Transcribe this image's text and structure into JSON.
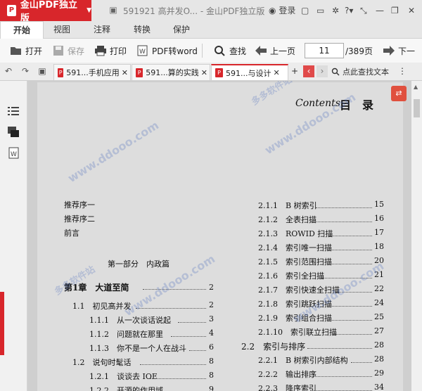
{
  "app": {
    "brand": "金山PDF独立版",
    "doc_title": "591921 高并发O... - 金山PDF独立版",
    "login": "登录",
    "help": "?",
    "help_caret": "▾"
  },
  "ribbon_tabs": [
    "开始",
    "视图",
    "注释",
    "转换",
    "保护"
  ],
  "toolbar": {
    "open": "打开",
    "save": "保存",
    "print": "打印",
    "to_word": "PDF转word",
    "find": "查找",
    "prev_page": "上一页",
    "current_page": "11",
    "total_pages": "/389页",
    "next_page": "下一"
  },
  "doc_tabs": [
    {
      "label": "591...手机应用"
    },
    {
      "label": "591...算的实践"
    },
    {
      "label": "591...与设计"
    }
  ],
  "search": {
    "placeholder": "点此查找文本"
  },
  "page": {
    "contents_script": "Contents",
    "contents_title": "目　录",
    "left_entries": [
      {
        "text": "推荐序一",
        "num": ""
      },
      {
        "text": "推荐序二",
        "num": ""
      },
      {
        "text": "前言",
        "num": ""
      },
      {
        "text": "第一部分　内政篇",
        "num": ""
      },
      {
        "text": "第1章　大道至简",
        "num": "2"
      },
      {
        "text": "1.1　初见高并发",
        "num": "2"
      },
      {
        "text": "1.1.1　从一次谈话说起",
        "num": "3"
      },
      {
        "text": "1.1.2　问题就在那里",
        "num": "4"
      },
      {
        "text": "1.1.3　你不是一个人在战斗",
        "num": "6"
      },
      {
        "text": "1.2　说句时髦话",
        "num": "8"
      },
      {
        "text": "1.2.1　谈谈去 IOE",
        "num": "8"
      },
      {
        "text": "1.2.2　开源的作用域",
        "num": "9"
      }
    ],
    "right_entries": [
      {
        "text": "2.1.1　B 树索引",
        "num": "15"
      },
      {
        "text": "2.1.2　全表扫描",
        "num": "16"
      },
      {
        "text": "2.1.3　ROWID 扫描",
        "num": "17"
      },
      {
        "text": "2.1.4　索引唯一扫描",
        "num": "18"
      },
      {
        "text": "2.1.5　索引范围扫描",
        "num": "20"
      },
      {
        "text": "2.1.6　索引全扫描",
        "num": "21"
      },
      {
        "text": "2.1.7　索引快速全扫描",
        "num": "22"
      },
      {
        "text": "2.1.8　索引跳跃扫描",
        "num": "24"
      },
      {
        "text": "2.1.9　索引组合扫描",
        "num": "25"
      },
      {
        "text": "2.1.10　索引联立扫描",
        "num": "27"
      },
      {
        "text": "2.2　索引与排序",
        "num": "28"
      },
      {
        "text": "2.2.1　B 树索引内部结构",
        "num": "28"
      },
      {
        "text": "2.2.2　输出排序",
        "num": "29"
      },
      {
        "text": "2.2.3　降序索引",
        "num": "34"
      }
    ]
  },
  "watermark": "www.ddooo.com",
  "watermark_cn": "多多软件站",
  "colors": {
    "brand_red": "#d8262b",
    "accent_red": "#e0503e"
  }
}
